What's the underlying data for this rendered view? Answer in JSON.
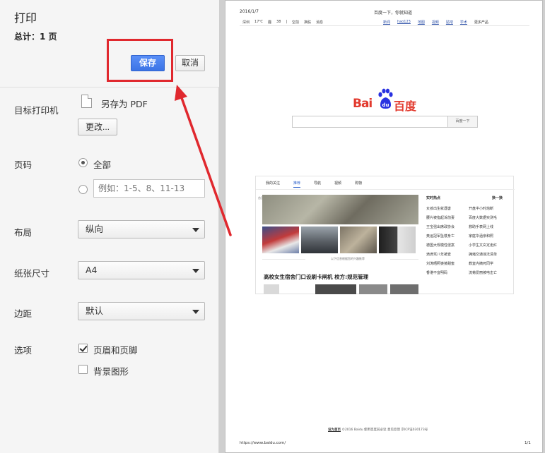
{
  "dialog": {
    "title": "打印",
    "total": "总计：1 页",
    "save_label": "保存",
    "cancel_label": "取消"
  },
  "settings": {
    "destination": {
      "label": "目标打印机",
      "value": "另存为 PDF",
      "change_label": "更改..."
    },
    "pages": {
      "label": "页码",
      "all_label": "全部",
      "custom_placeholder": "例如：1-5、8、11-13"
    },
    "layout": {
      "label": "布局",
      "value": "纵向"
    },
    "paper_size": {
      "label": "纸张尺寸",
      "value": "A4"
    },
    "margins": {
      "label": "边距",
      "value": "默认"
    },
    "options": {
      "label": "选项",
      "header_footer": {
        "label": "页眉和页脚",
        "checked": true
      },
      "background": {
        "label": "背景图形",
        "checked": false
      }
    }
  },
  "preview": {
    "date": "2016/1/7",
    "heading": "百度一下，你就知道",
    "nav_left": [
      "深圳",
      "17℃",
      "霾",
      "38",
      "|",
      "空前",
      "换肤",
      "消息"
    ],
    "nav_right": [
      "新闻",
      "hao123",
      "地图",
      "视频",
      "贴吧",
      "学术",
      "更多产品"
    ],
    "search_button": "百度一下",
    "tabs": [
      "我的关注",
      "推荐",
      "导航",
      "视频",
      "购物"
    ],
    "side_label": "首页",
    "tip": "以下信息根据您的兴趣推荐",
    "headline": "高校女生宿舍门口设刷卡闸机 校方:规范管理",
    "hot_title": "实时热点",
    "hot_switch": "换一换",
    "hot_items": [
      "女孩出生就遇害",
      "开盘半小时熔断",
      "腰片被指起诉前妻",
      "百度大数据实测毛",
      "王宝强出席政协会",
      "救助手表网上线",
      "奥运冠军坠楼身亡",
      "家庭华涵亲和照",
      "德国大规模性侵案",
      "小学生文玄定走红",
      "滴滴驾八年被查",
      "拥堵交通违法清单",
      "刘涛晒照婆婆甜蜜",
      "教室内摘死同学",
      "香港不宜明码",
      "流菊爱丽被电击亡"
    ],
    "footer_links": "设为首页",
    "footer": "©2016 Baidu 使用百度前必读 意见反馈 京ICP证030173号",
    "url": "https://www.baidu.com/",
    "page_num": "1/1"
  },
  "colors": {
    "accent": "#3c74e6",
    "highlight": "#e0282e",
    "baidu_red": "#e23a2e",
    "baidu_blue": "#2932e1"
  }
}
